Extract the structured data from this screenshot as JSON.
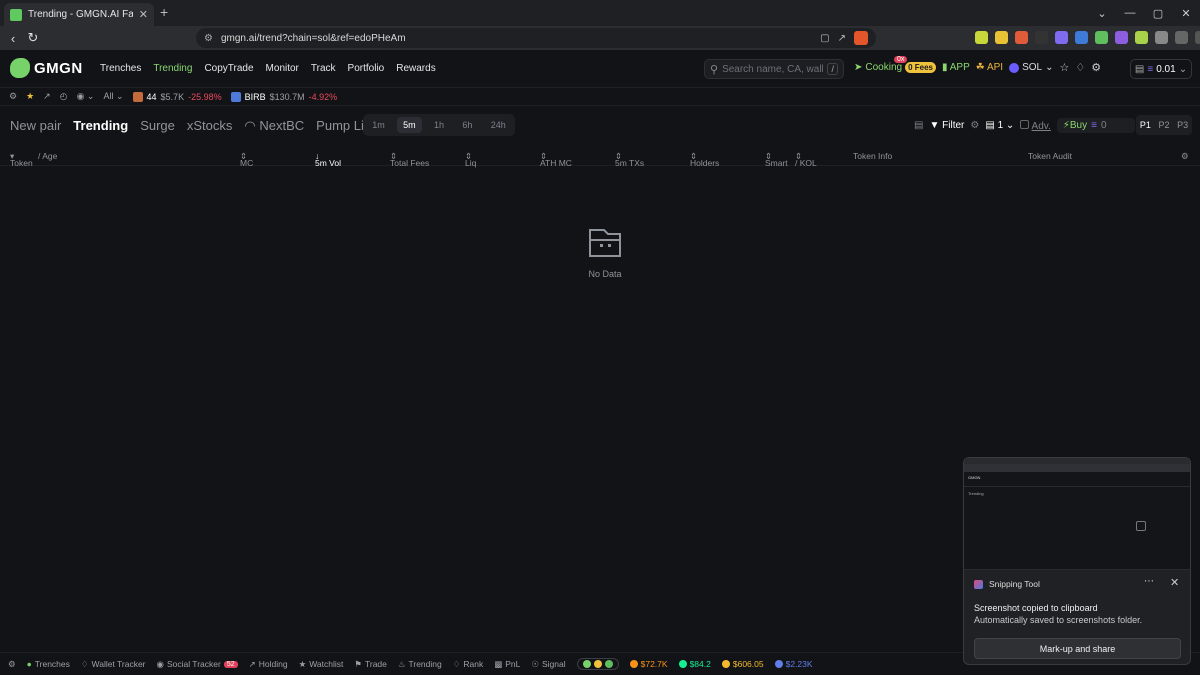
{
  "browser": {
    "tab_title": "Trending - GMGN.AI Fast Trade, F",
    "tab_close": "✕",
    "new_tab": "+",
    "url": "gmgn.ai/trend?chain=sol&ref=edoPHeAm",
    "window_controls": [
      "⌄",
      "—",
      "▢",
      "✕"
    ]
  },
  "header": {
    "logo_text": "GMGN",
    "nav": [
      "Trenches",
      "Trending",
      "CopyTrade",
      "Monitor",
      "Track",
      "Portfolio",
      "Rewards"
    ],
    "active_nav": "Trending",
    "search_placeholder": "Search name, CA, wallet",
    "search_shortcut": "/",
    "cooking_label": "Cooking",
    "cooking_badge": "0 Fees",
    "cooking_notif": "0x",
    "app_label": "APP",
    "api_label": "API",
    "chain_label": "SOL",
    "wallet_value": "0.01"
  },
  "ticker": {
    "filter_label": "All",
    "items": [
      {
        "name": "44",
        "mc": "$5.7K",
        "change": "-25.98%"
      },
      {
        "name": "BIRB",
        "mc": "$130.7M",
        "change": "-4.92%"
      }
    ]
  },
  "subnav": {
    "tabs": [
      "New pair",
      "Trending",
      "Surge",
      "xStocks",
      "NextBC",
      "Pump Live"
    ],
    "active_tab": "Trending",
    "timeframes": [
      "1m",
      "5m",
      "1h",
      "6h",
      "24h"
    ],
    "active_timeframe": "5m",
    "filter_label": "Filter",
    "count_value": "1",
    "adv_label": "Adv.",
    "buy_label": "Buy",
    "buy_amount": "0",
    "pages": [
      "P1",
      "P2",
      "P3"
    ],
    "active_page": "P1"
  },
  "table": {
    "columns": {
      "token": "Token",
      "age": "/ Age",
      "mc": "MC",
      "vol": "5m Vol",
      "fees": "Total Fees",
      "liq": "Liq",
      "athmc": "ATH MC",
      "txs": "5m TXs",
      "holders": "Holders",
      "smart": "Smart",
      "kol": "/ KOL",
      "info": "Token Info",
      "audit": "Token Audit"
    },
    "empty_text": "No Data"
  },
  "footer": {
    "items": [
      "Trenches",
      "Wallet Tracker",
      "Social Tracker",
      "Holding",
      "Watchlist",
      "Trade",
      "Trending",
      "Rank",
      "PnL",
      "Signal"
    ],
    "social_badge": "52",
    "prices": [
      {
        "value": "$72.7K",
        "color": "#f7931a"
      },
      {
        "value": "$84.2",
        "color": "#14f195"
      },
      {
        "value": "$606.05",
        "color": "#f3ba2f"
      },
      {
        "value": "$2.23K",
        "color": "#627eea"
      }
    ]
  },
  "snipping_tool": {
    "app_name": "Snipping Tool",
    "title": "Screenshot copied to clipboard",
    "subtitle": "Automatically saved to screenshots folder.",
    "button": "Mark-up and share"
  },
  "colors": {
    "accent_green": "#88d672",
    "negative": "#ea4a5e",
    "background": "#121316"
  }
}
